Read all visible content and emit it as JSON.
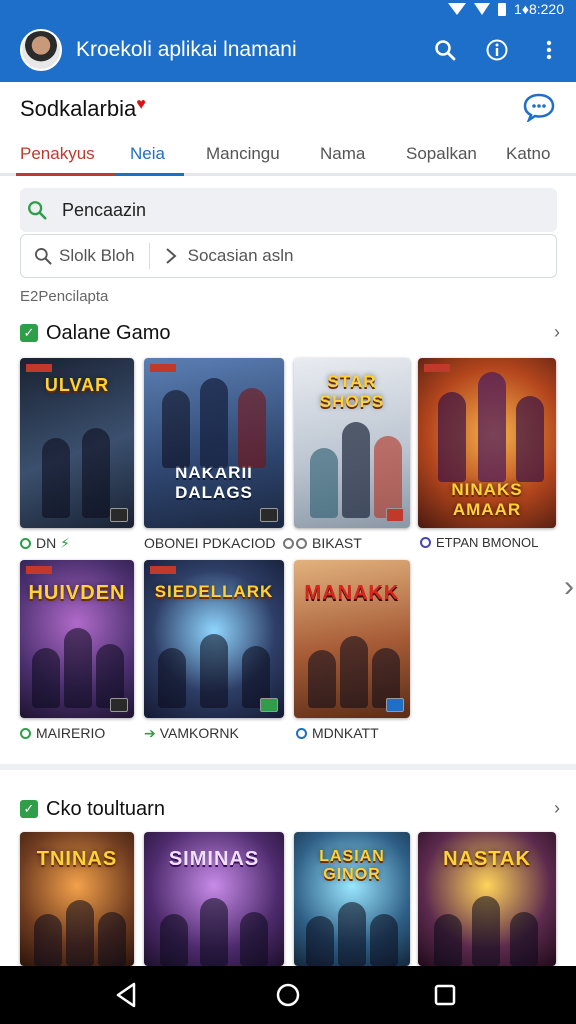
{
  "status": {
    "time": "1♦8:220"
  },
  "appbar": {
    "title": "Kroekoli aplikai lnamani"
  },
  "page": {
    "title": "Sodkalarbia"
  },
  "tabs": [
    {
      "label": "Penakyus"
    },
    {
      "label": "Neia"
    },
    {
      "label": "Mancingu"
    },
    {
      "label": "Nama"
    },
    {
      "label": "Sopalkan"
    },
    {
      "label": "Katno"
    }
  ],
  "search": {
    "label": "Pencaazin"
  },
  "filter": {
    "left": "Slolk Bloh",
    "right": "Socasian asln"
  },
  "caption_small": "E2Pencilapta",
  "sections": [
    {
      "title": "Oalane Gamo",
      "cards": [
        {
          "art": "ULVAR",
          "label": "DN",
          "bg": "#2b3b55"
        },
        {
          "art": "NAKARII DALAGS",
          "label": "OBONEI PDKACIOD",
          "bg": "#3f5f8f"
        },
        {
          "art": "STAR SHOPS",
          "label": "BIKAST",
          "bg": "#cfd4dc"
        },
        {
          "art": "NINAKS AMAAR",
          "label": "ETPAN BMONOL",
          "bg": "#8b3a1e"
        },
        {
          "art": "HUIVDEN",
          "label": "MAIRERIO",
          "bg": "#4a2f6e"
        },
        {
          "art": "SIEDELLARK",
          "label": "VAMKORNK",
          "bg": "#2e3e66"
        },
        {
          "art": "MANAKK",
          "label": "MDNKATT",
          "bg": "#a65b36"
        }
      ]
    },
    {
      "title": "Cko toultuarn",
      "cards": [
        {
          "art": "TNINAS",
          "bg": "#6e3b20"
        },
        {
          "art": "SIMINAS",
          "bg": "#4e2b6d"
        },
        {
          "art": "LASIAN GINOR",
          "bg": "#2f5f86"
        },
        {
          "art": "NASTAK",
          "bg": "#5c2a4d"
        }
      ]
    }
  ]
}
